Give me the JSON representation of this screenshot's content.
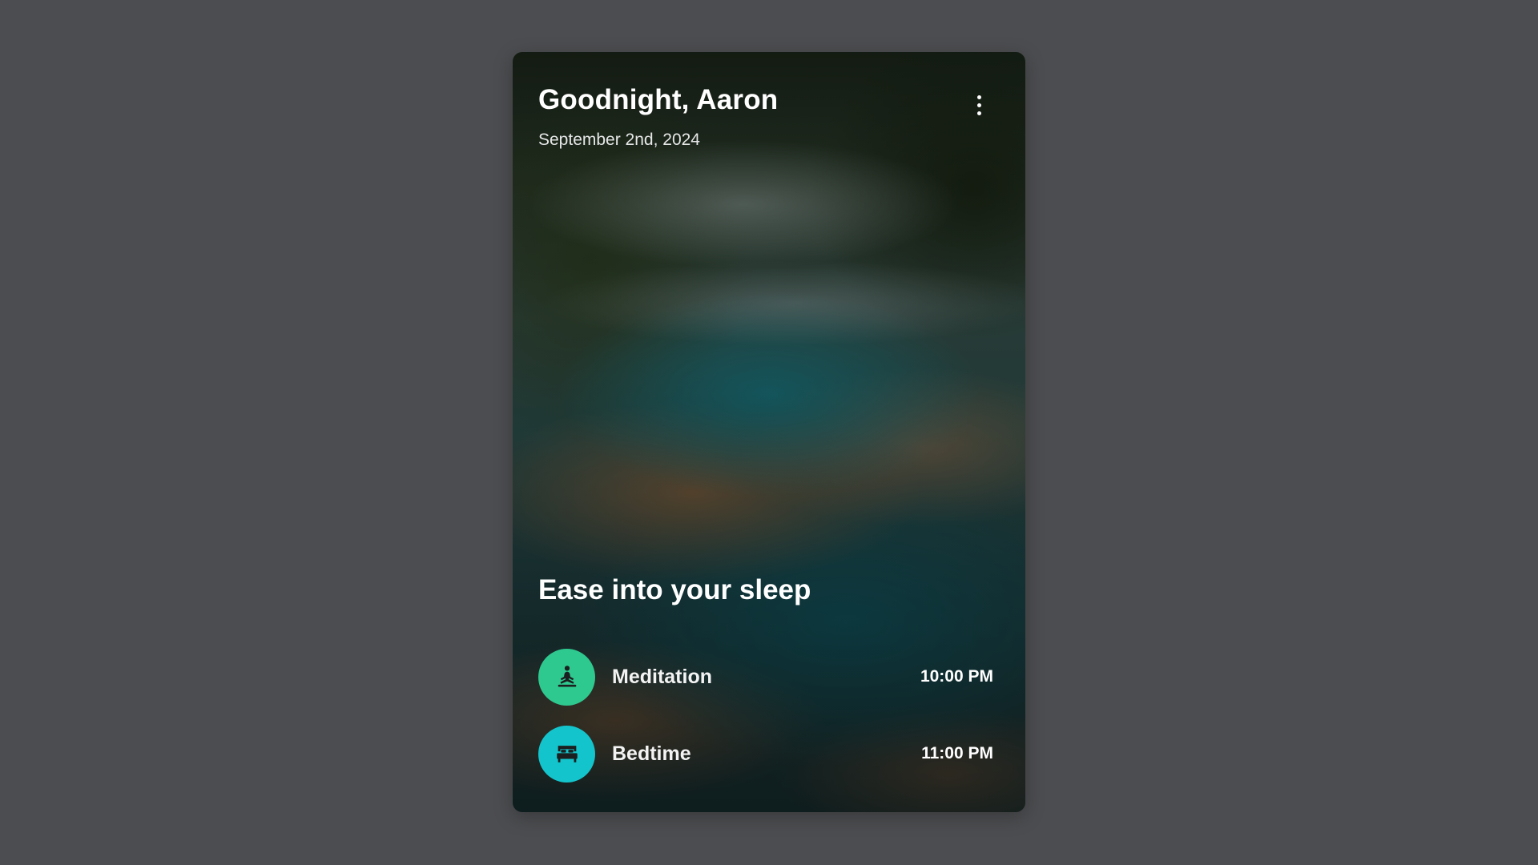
{
  "card": {
    "greeting": "Goodnight, Aaron",
    "date": "September 2nd, 2024",
    "menu_icon": "more-vertical-icon"
  },
  "section": {
    "title": "Ease into your sleep"
  },
  "routines": [
    {
      "name": "Meditation",
      "time": "10:00 PM",
      "icon": "meditation-icon",
      "color": "#2ec98f"
    },
    {
      "name": "Bedtime",
      "time": "11:00 PM",
      "icon": "bed-icon",
      "color": "#14c4cc"
    }
  ],
  "colors": {
    "background": "#4c4d50",
    "text": "#ffffff",
    "icon_glyph": "#1b1f1f"
  }
}
